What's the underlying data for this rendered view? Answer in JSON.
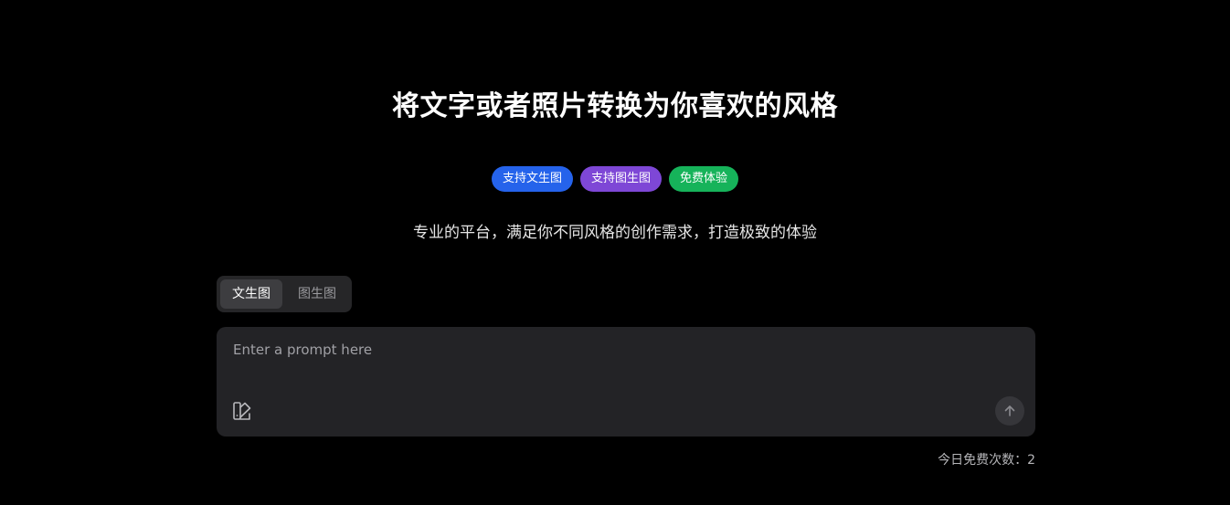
{
  "header": {
    "title": "将文字或者照片转换为你喜欢的风格",
    "subtitle": "专业的平台，满足你不同风格的创作需求，打造极致的体验"
  },
  "badges": [
    {
      "label": "支持文生图",
      "color": "#2563eb"
    },
    {
      "label": "支持图生图",
      "color": "#7e47d6"
    },
    {
      "label": "免费体验",
      "color": "#16b35a"
    }
  ],
  "mode_tabs": [
    {
      "label": "文生图",
      "active": true
    },
    {
      "label": "图生图",
      "active": false
    }
  ],
  "prompt": {
    "placeholder": "Enter a prompt here",
    "value": "",
    "style_icon": "brush-palette-icon",
    "send_icon": "arrow-up-icon"
  },
  "quota": {
    "label": "今日免费次数：",
    "count": "2"
  }
}
